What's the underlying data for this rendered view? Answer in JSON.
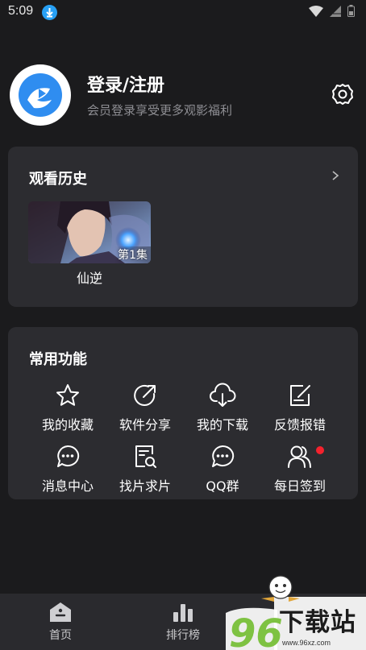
{
  "status_bar": {
    "time": "5:09"
  },
  "profile": {
    "title": "登录/注册",
    "subtitle": "会员登录享受更多观影福利"
  },
  "history": {
    "title": "观看历史",
    "items": [
      {
        "episode": "第1集",
        "name": "仙逆"
      }
    ]
  },
  "functions": {
    "title": "常用功能",
    "items": [
      {
        "label": "我的收藏",
        "icon": "star-icon"
      },
      {
        "label": "软件分享",
        "icon": "share-icon"
      },
      {
        "label": "我的下载",
        "icon": "cloud-download-icon"
      },
      {
        "label": "反馈报错",
        "icon": "edit-icon"
      },
      {
        "label": "消息中心",
        "icon": "message-icon"
      },
      {
        "label": "找片求片",
        "icon": "search-list-icon"
      },
      {
        "label": "QQ群",
        "icon": "chat-icon"
      },
      {
        "label": "每日签到",
        "icon": "users-icon"
      }
    ]
  },
  "tabbar": {
    "home": "首页",
    "rank": "排行榜"
  },
  "watermark": {
    "brand": "下载站",
    "number": "96",
    "url": "www.96xz.com"
  },
  "colors": {
    "background": "#1b1b1d",
    "card": "#2c2c30",
    "accent_red": "#f5222d",
    "badge_blue": "#27a0f5"
  }
}
